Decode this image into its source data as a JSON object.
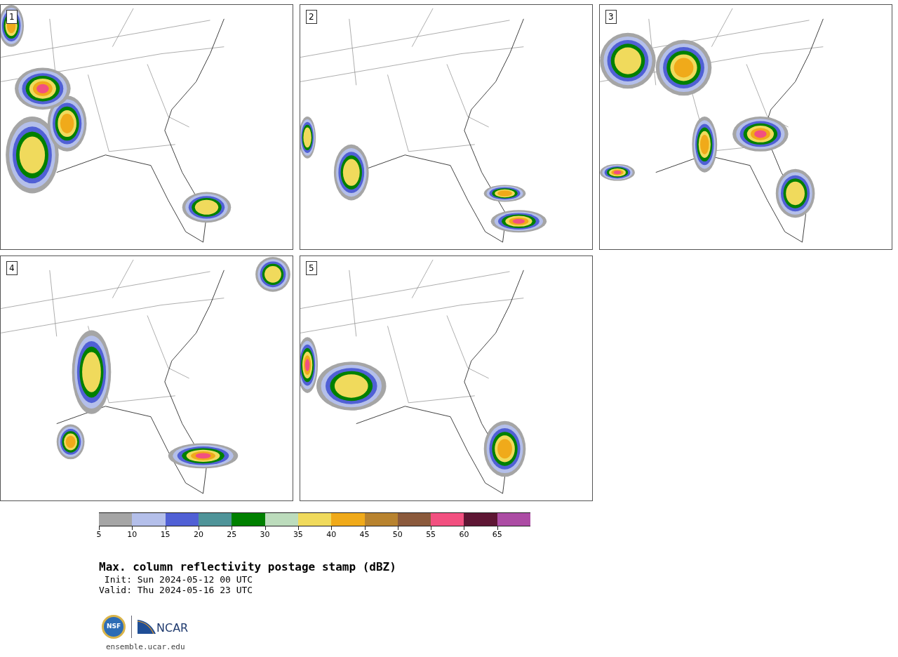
{
  "panels": [
    {
      "label": "1"
    },
    {
      "label": "2"
    },
    {
      "label": "3"
    },
    {
      "label": "4"
    },
    {
      "label": "5"
    }
  ],
  "colorbar": {
    "segments": [
      {
        "color": "#a5a5a5"
      },
      {
        "color": "#b4bfea"
      },
      {
        "color": "#5060d5"
      },
      {
        "color": "#4f9499"
      },
      {
        "color": "#008000"
      },
      {
        "color": "#bcdcbc"
      },
      {
        "color": "#f0da5c"
      },
      {
        "color": "#f0aa1a"
      },
      {
        "color": "#b8832f"
      },
      {
        "color": "#8b5a3c"
      },
      {
        "color": "#f25080"
      },
      {
        "color": "#5e1634"
      },
      {
        "color": "#ac4ca4"
      }
    ],
    "ticks": [
      "5",
      "10",
      "15",
      "20",
      "25",
      "30",
      "35",
      "40",
      "45",
      "50",
      "55",
      "60",
      "65"
    ]
  },
  "title": "Max. column reflectivity postage stamp (dBZ)",
  "init": " Init: Sun 2024-05-12 00 UTC",
  "valid": "Valid: Thu 2024-05-16 23 UTC",
  "logo": {
    "nsf": "NSF",
    "ncar": "NCAR"
  },
  "url": "ensemble.ucar.edu"
}
